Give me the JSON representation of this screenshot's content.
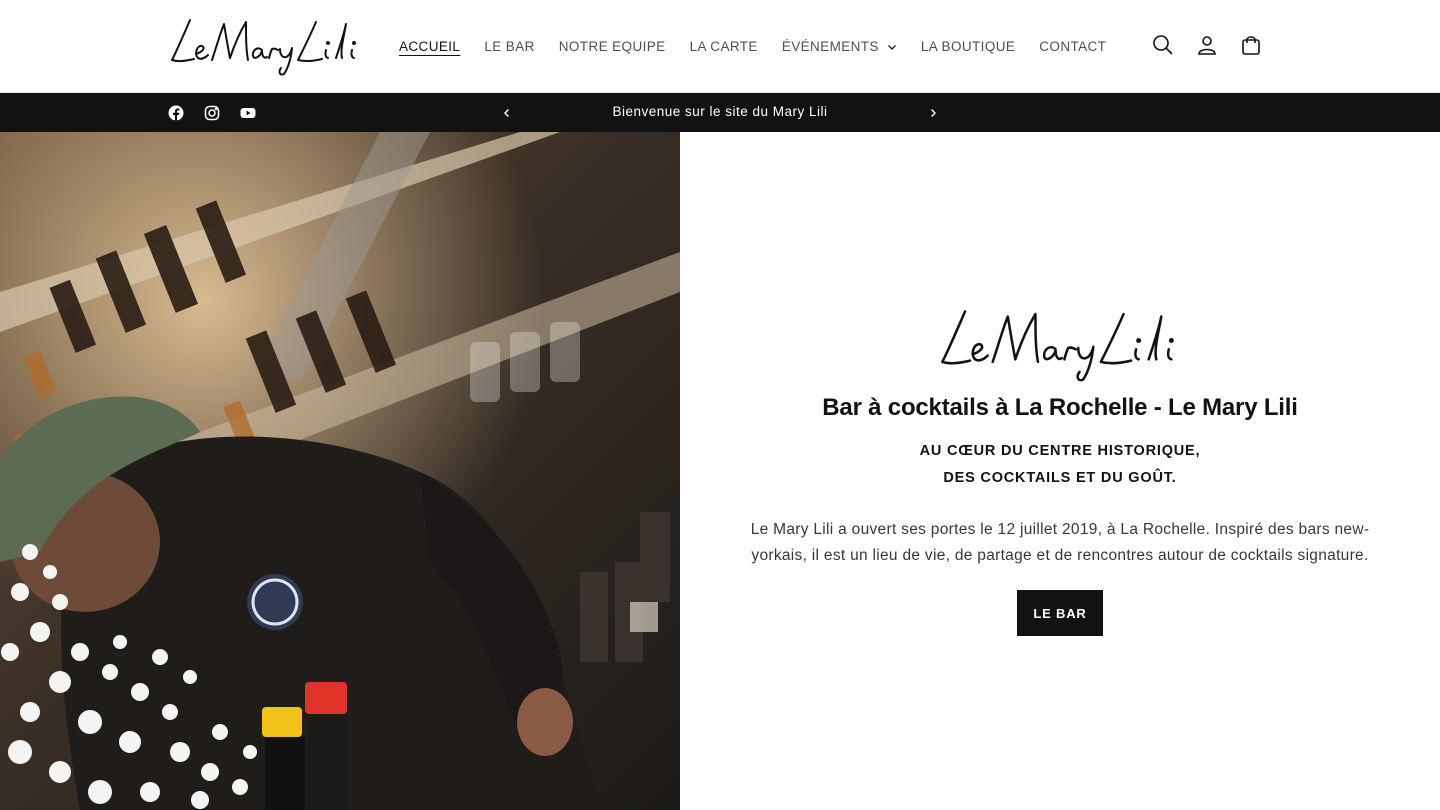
{
  "brand": {
    "name": "LeMaryLili"
  },
  "nav": {
    "items": [
      {
        "label": "ACCUEIL",
        "active": true
      },
      {
        "label": "LE BAR"
      },
      {
        "label": "NOTRE EQUIPE"
      },
      {
        "label": "LA CARTE"
      },
      {
        "label": "ÉVÉNEMENTS",
        "dropdown": true
      },
      {
        "label": "LA BOUTIQUE"
      },
      {
        "label": "CONTACT"
      }
    ]
  },
  "header_icons": [
    "search-icon",
    "account-icon",
    "cart-icon"
  ],
  "social_icons": [
    "facebook-icon",
    "instagram-icon",
    "youtube-icon"
  ],
  "announcement": {
    "text": "Bienvenue sur le site du Mary Lili"
  },
  "hero": {
    "title": "Bar à cocktails à La Rochelle - Le Mary Lili",
    "subtitle_line1": "AU CŒUR DU CENTRE HISTORIQUE,",
    "subtitle_line2": "DES COCKTAILS ET DU GOÛT.",
    "description": "Le Mary Lili a ouvert ses portes le 12 juillet 2019, à La Rochelle. Inspiré des bars new-yorkais, il est un lieu de vie, de partage et de rencontres autour de cocktails signature.",
    "button_label": "LE BAR"
  },
  "colors": {
    "announcement_bg": "#121212",
    "text": "#121212",
    "button_bg": "#121212"
  }
}
